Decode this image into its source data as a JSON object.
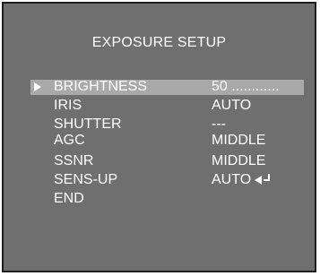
{
  "menu": {
    "title": "EXPOSURE SETUP",
    "items": [
      {
        "label": "BRIGHTNESS",
        "value": "50 ............"
      },
      {
        "label": "IRIS",
        "value": "AUTO"
      },
      {
        "label": "SHUTTER",
        "value": "---"
      },
      {
        "label": "AGC",
        "value": "MIDDLE"
      },
      {
        "label": "SSNR",
        "value": "MIDDLE"
      },
      {
        "label": "SENS-UP",
        "value": "AUTO"
      },
      {
        "label": "END",
        "value": ""
      }
    ],
    "selected_item": "BRIGHTNESS",
    "cursor_icon": "triangle-right-icon",
    "submenu_icon": "enter-arrow-icon"
  },
  "colors": {
    "background": "#6f6f6f",
    "highlight": "#a9a9a9",
    "text": "#ffffff"
  }
}
